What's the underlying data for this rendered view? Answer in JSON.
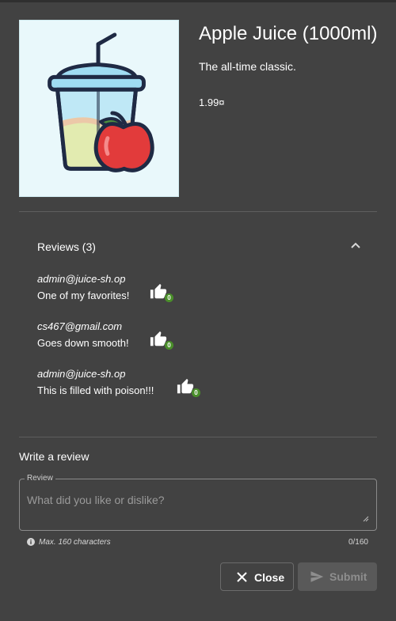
{
  "product": {
    "title": "Apple Juice (1000ml)",
    "description": "The all-time classic.",
    "price": "1.99¤",
    "image_icon": "juice-cup-with-apple-icon"
  },
  "reviews": {
    "title": "Reviews (3)",
    "expanded": true,
    "items": [
      {
        "author": "admin@juice-sh.op",
        "text": "One of my favorites!",
        "likes": "0"
      },
      {
        "author": "cs467@gmail.com",
        "text": "Goes down smooth!",
        "likes": "0"
      },
      {
        "author": "admin@juice-sh.op",
        "text": "This is filled with poison!!!",
        "likes": "0"
      }
    ]
  },
  "write_review": {
    "title": "Write a review",
    "field_label": "Review",
    "placeholder": "What did you like or dislike?",
    "hint": "Max. 160 characters",
    "char_count": "0/160"
  },
  "actions": {
    "close_label": "Close",
    "submit_label": "Submit"
  },
  "colors": {
    "background": "#424242",
    "like_badge": "#4a8f2a",
    "submit_disabled_bg": "#595959"
  }
}
